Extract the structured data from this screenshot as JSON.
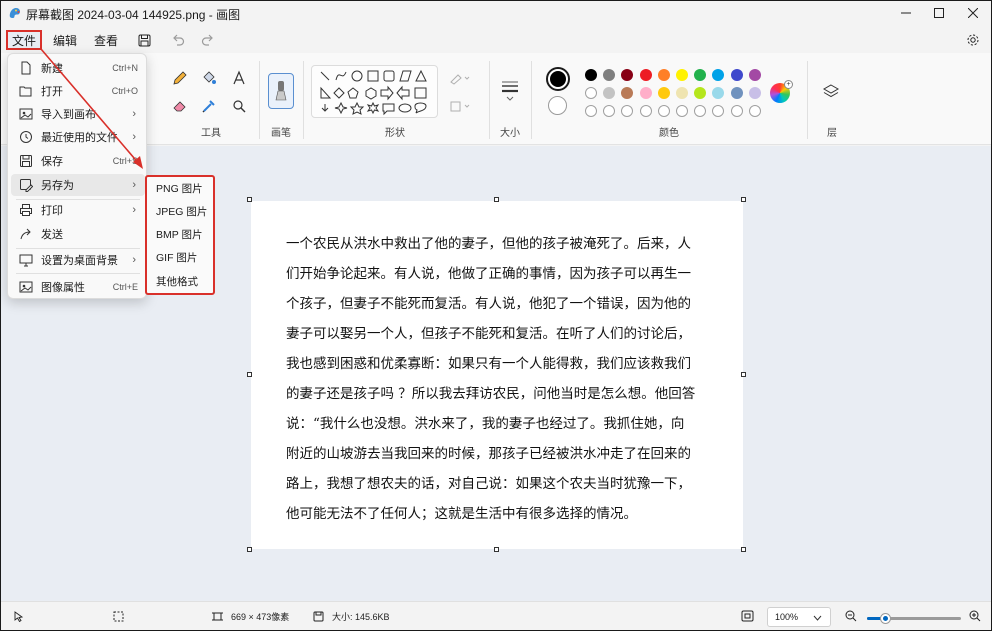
{
  "window": {
    "title": "屏幕截图 2024-03-04 144925.png - 画图",
    "controls": {
      "minimize": "—",
      "maximize": "☐",
      "close": "✕"
    }
  },
  "menubar": {
    "file": "文件",
    "edit": "编辑",
    "view": "查看"
  },
  "ribbon": {
    "groups": {
      "tools": "工具",
      "brushes": "画笔",
      "shapes": "形状",
      "size": "大小",
      "colors": "颜色",
      "layers": "层"
    },
    "palette_row1": [
      "#000000",
      "#7f7f7f",
      "#880015",
      "#ed1c24",
      "#ff7f27",
      "#fff200",
      "#22b14c",
      "#00a2e8",
      "#3f48cc",
      "#a349a4"
    ],
    "palette_row2": [
      "#ffffff",
      "#c3c3c3",
      "#b97a57",
      "#ffaec9",
      "#ffc90e",
      "#efe4b0",
      "#b5e61d",
      "#99d9ea",
      "#7092be",
      "#c8bfe7"
    ],
    "primary_color": "#000000",
    "secondary_color": "#ffffff"
  },
  "file_menu": {
    "items": [
      {
        "label": "新建",
        "shortcut": "Ctrl+N",
        "icon": "new-file-icon"
      },
      {
        "label": "打开",
        "shortcut": "Ctrl+O",
        "icon": "open-folder-icon"
      },
      {
        "label": "导入到画布",
        "icon": "import-icon"
      },
      {
        "label": "最近使用的文件",
        "icon": "clock-icon"
      },
      {
        "label": "保存",
        "shortcut": "Ctrl+S",
        "icon": "save-icon"
      },
      {
        "label": "另存为",
        "icon": "save-as-icon"
      },
      {
        "label": "打印",
        "icon": "printer-icon"
      },
      {
        "label": "发送",
        "icon": "send-icon"
      },
      {
        "label": "设置为桌面背景",
        "icon": "desktop-background-icon"
      },
      {
        "label": "图像属性",
        "shortcut": "Ctrl+E",
        "icon": "image-properties-icon"
      }
    ],
    "save_as_submenu": [
      "PNG 图片",
      "JPEG 图片",
      "BMP 图片",
      "GIF 图片",
      "其他格式"
    ]
  },
  "canvas": {
    "lines": [
      "一个农民从洪水中救出了他的妻子，但他的孩子被淹死了。后来，人",
      "们开始争论起来。有人说，他做了正确的事情，因为孩子可以再生一",
      "个孩子，但妻子不能死而复活。有人说，他犯了一个错误，因为他的",
      "妻子可以娶另一个人，但孩子不能死和复活。在听了人们的讨论后，",
      "我也感到困惑和优柔寡断：如果只有一个人能得救，我们应该救我们",
      "的妻子还是孩子吗 ？所以我去拜访农民，问他当时是怎么想。他回答",
      "说：“我什么也没想。洪水来了，我的妻子也经过了。我抓住她，向",
      "附近的山坡游去当我回来的时候，那孩子已经被洪水冲走了在回来的",
      "路上，我想了想农夫的话，对自己说：如果这个农夫当时犹豫一下，",
      "他可能无法不了任何人；这就是生活中有很多选择的情况。"
    ]
  },
  "statusbar": {
    "dimensions": "669 × 473像素",
    "size": "大小: 145.6KB",
    "zoom": "100%",
    "zoom_level": 0.2
  }
}
